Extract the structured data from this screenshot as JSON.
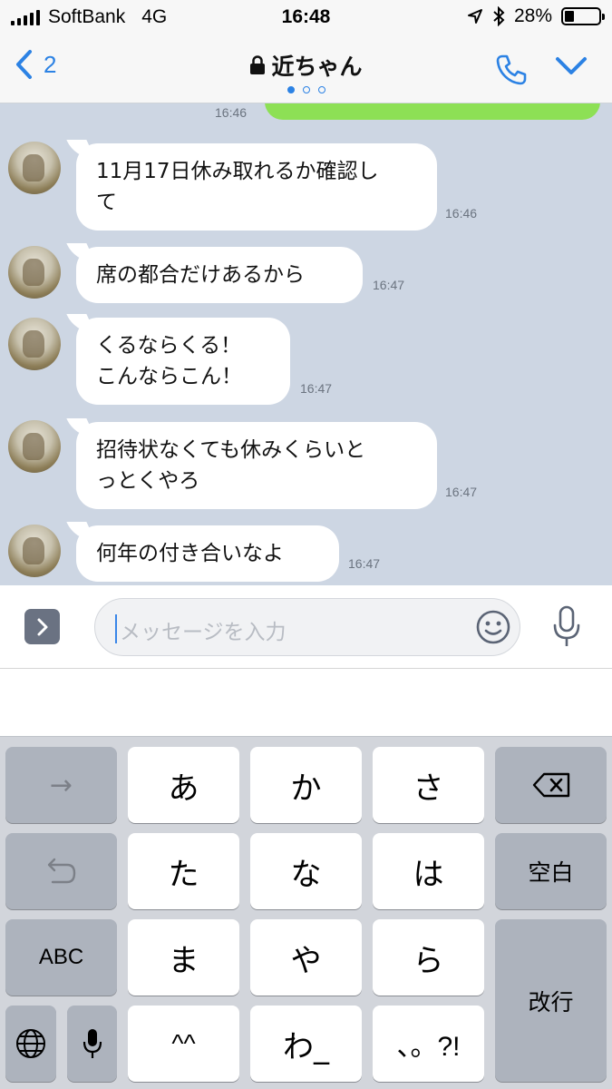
{
  "status": {
    "carrier": "SoftBank",
    "network": "4G",
    "time": "16:48",
    "battery": "28%"
  },
  "nav": {
    "back_count": "2",
    "title": "近ちゃん",
    "page_dots": 3,
    "active_dot": 0,
    "accent": "#2c82e4"
  },
  "chat": {
    "background": "#cdd6e3",
    "partial_time": "16:46",
    "messages": [
      {
        "text": "11月17日休み取れるか確認して",
        "line1": "11月17日休み取れるか確認し",
        "line2": "て",
        "time": "16:46"
      },
      {
        "text": "席の都合だけあるから",
        "line1": "席の都合だけあるから",
        "line2": "",
        "time": "16:47"
      },
      {
        "text": "くるならくる！こんならこん！",
        "line1": "くるならくる！",
        "line2": "こんならこん！",
        "time": "16:47"
      },
      {
        "text": "招待状なくても休みくらいとっとくやろ",
        "line1": "招待状なくても休みくらいと",
        "line2": "っとくやろ",
        "time": "16:47"
      },
      {
        "text": "何年の付き合いなよ",
        "line1": "何年の付き合いなよ",
        "line2": "",
        "time": "16:47"
      }
    ]
  },
  "input": {
    "placeholder": "メッセージを入力"
  },
  "keyboard": {
    "arrow": "→",
    "a": "あ",
    "ka": "か",
    "sa": "さ",
    "ta": "た",
    "na": "な",
    "ha": "は",
    "space": "空白",
    "abc": "ABC",
    "ma": "ま",
    "ya": "や",
    "ra": "ら",
    "enter": "改行",
    "kao": "^^",
    "wa": "わ_",
    "punct": "、。?!"
  }
}
